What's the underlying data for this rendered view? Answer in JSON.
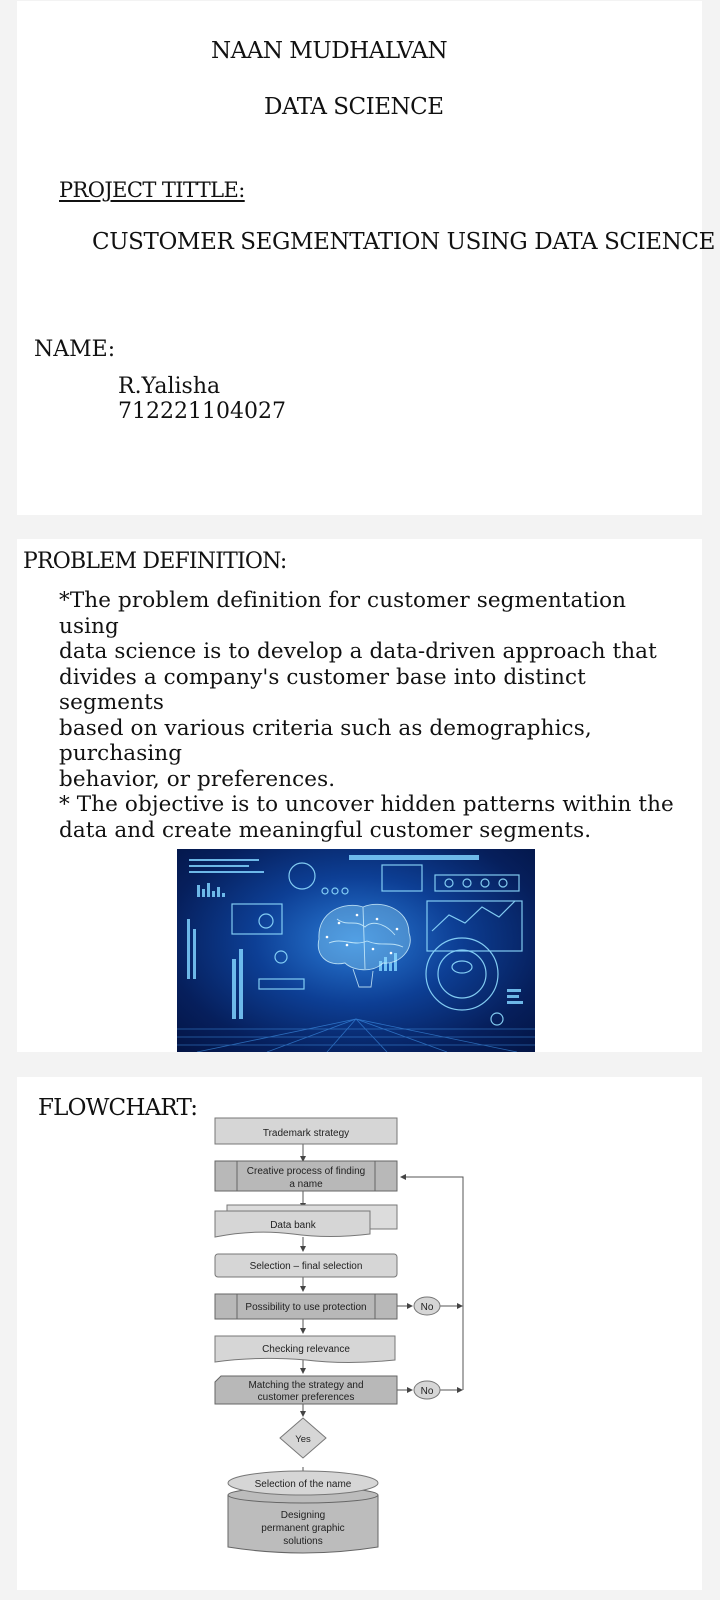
{
  "cover": {
    "heading": "NAAN MUDHALVAN",
    "subject": "DATA SCIENCE",
    "project_label": "PROJECT TITTLE:",
    "project_title": "CUSTOMER SEGMENTATION USING DATA SCIENCE",
    "name_label": "NAME:",
    "student_name": "R.Yalisha",
    "student_id": "712221104027"
  },
  "problem": {
    "heading": "PROBLEM DEFINITION:",
    "line1": "*The problem definition for customer segmentation using",
    "line2": "data science is to develop a data-driven approach that",
    "line3": "divides a company's customer base into distinct segments",
    "line4": "based on various criteria such as demographics, purchasing",
    "line5": "behavior, or preferences.",
    "line6": "* The objective is to uncover hidden patterns within the",
    "line7": "data and create meaningful customer segments.",
    "image_icon": "ai-brain-illustration"
  },
  "flowchart": {
    "heading": "FLOWCHART:",
    "steps": {
      "trademark": "Trademark strategy",
      "creative_1": "Creative process of finding",
      "creative_2": "a name",
      "databank": "Data bank",
      "selection": "Selection – final selection",
      "possibility": "Possibility to use protection",
      "checking": "Checking relevance",
      "matching_1": "Matching the strategy and",
      "matching_2": "customer preferences",
      "yes": "Yes",
      "no_1": "No",
      "no_2": "No",
      "name_selection": "Selection of the name",
      "designing_1": "Designing",
      "designing_2": "permanent graphic",
      "designing_3": "solutions"
    }
  }
}
